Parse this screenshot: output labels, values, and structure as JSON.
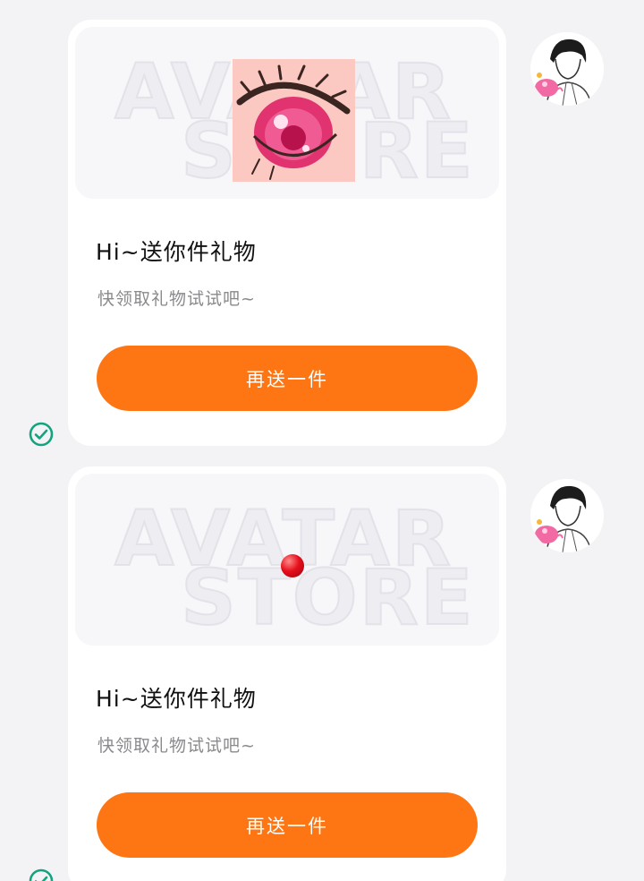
{
  "messages": [
    {
      "gift_variant": "eye-gift",
      "title": "Hi~送你件礼物",
      "subtitle": "快领取礼物试试吧~",
      "button_label": "再送一件",
      "watermark": [
        "AVATAR",
        "STORE"
      ],
      "sent_status_icon": "check-circle-icon"
    },
    {
      "gift_variant": "red-dot-gift",
      "title": "Hi~送你件礼物",
      "subtitle": "快领取礼物试试吧~",
      "button_label": "再送一件",
      "watermark": [
        "AVATAR",
        "STORE"
      ],
      "sent_status_icon": "check-circle-icon"
    }
  ],
  "colors": {
    "background": "#f3f3f5",
    "card": "#ffffff",
    "button": "#fd7613",
    "button_text": "#ffffff",
    "title": "#111111",
    "subtitle": "#8a8a8e",
    "check": "#14a37f"
  }
}
